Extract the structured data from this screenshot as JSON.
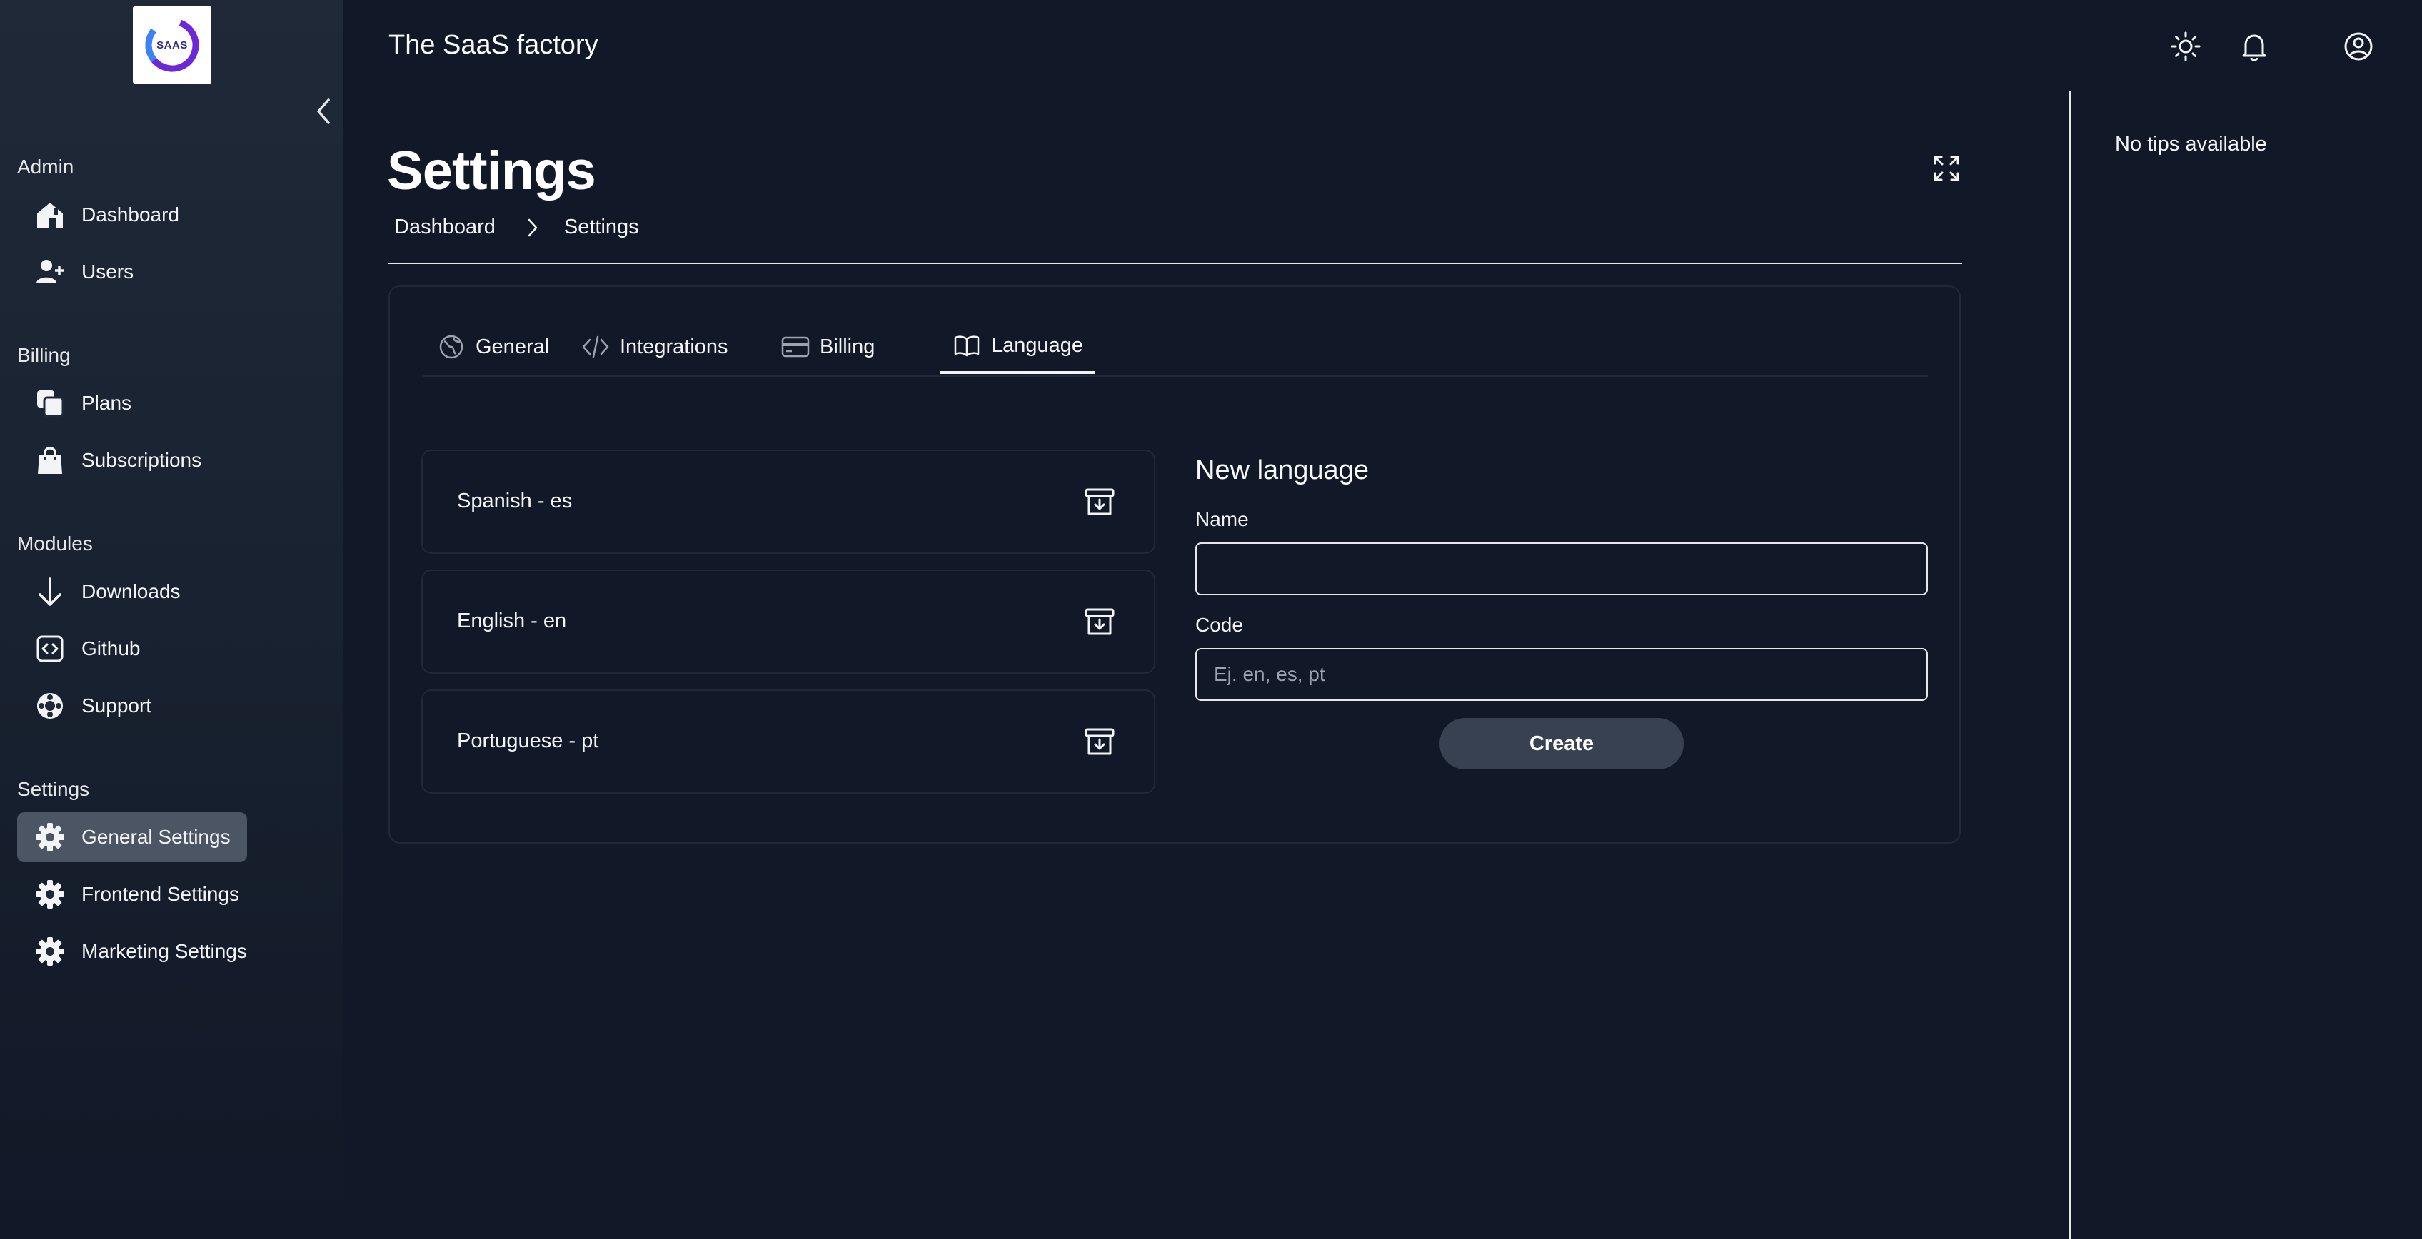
{
  "app": {
    "title": "The SaaS factory",
    "logo_text": "SAAS"
  },
  "sidebar": {
    "sections": [
      {
        "title": "Admin",
        "items": [
          {
            "label": "Dashboard",
            "icon": "home-icon"
          },
          {
            "label": "Users",
            "icon": "user-plus-icon"
          }
        ]
      },
      {
        "title": "Billing",
        "items": [
          {
            "label": "Plans",
            "icon": "copy-icon"
          },
          {
            "label": "Subscriptions",
            "icon": "shopping-bag-icon"
          }
        ]
      },
      {
        "title": "Modules",
        "items": [
          {
            "label": "Downloads",
            "icon": "arrow-down-icon"
          },
          {
            "label": "Github",
            "icon": "code-square-icon"
          },
          {
            "label": "Support",
            "icon": "lifebuoy-icon"
          }
        ]
      },
      {
        "title": "Settings",
        "items": [
          {
            "label": "General Settings",
            "icon": "gear-icon",
            "active": true
          },
          {
            "label": "Frontend Settings",
            "icon": "gear-icon"
          },
          {
            "label": "Marketing Settings",
            "icon": "gear-icon"
          }
        ]
      }
    ]
  },
  "page": {
    "title": "Settings",
    "breadcrumb": [
      "Dashboard",
      "Settings"
    ]
  },
  "tabs": [
    {
      "label": "General",
      "icon": "globe-icon"
    },
    {
      "label": "Integrations",
      "icon": "code-icon"
    },
    {
      "label": "Billing",
      "icon": "credit-card-icon"
    },
    {
      "label": "Language",
      "icon": "book-icon",
      "active": true
    }
  ],
  "languages": [
    {
      "label": "Spanish - es"
    },
    {
      "label": "English - en"
    },
    {
      "label": "Portuguese - pt"
    }
  ],
  "form": {
    "title": "New language",
    "name_label": "Name",
    "name_value": "",
    "code_label": "Code",
    "code_placeholder": "Ej. en, es, pt",
    "code_value": "",
    "submit_label": "Create"
  },
  "tips": {
    "text": "No tips available"
  },
  "colors": {
    "background": "#111827",
    "sidebar": "#1f2937",
    "active_item": "#4b5563",
    "button": "#374151",
    "border": "#1f2937",
    "text": "#f3f4f6"
  }
}
